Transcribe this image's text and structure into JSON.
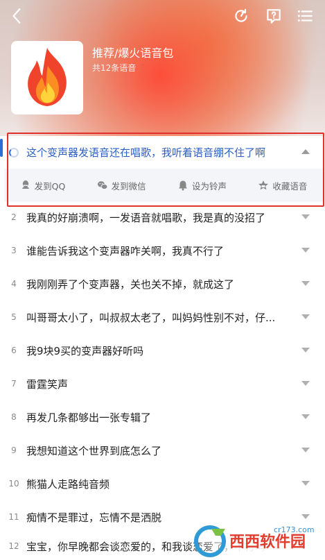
{
  "header": {
    "pack_title": "推荐/爆火语音包",
    "pack_count": "共12条语音"
  },
  "active": {
    "index": "1",
    "text": "这个变声器发语音还在唱歌，我听着语音绷不住了啊",
    "actions": [
      {
        "label": "发到QQ",
        "icon": "qq-icon"
      },
      {
        "label": "发到微信",
        "icon": "wechat-icon"
      },
      {
        "label": "设为铃声",
        "icon": "bell-icon"
      },
      {
        "label": "收藏语音",
        "icon": "star-icon"
      }
    ]
  },
  "items": [
    {
      "num": "2",
      "text": "我真的好崩溃啊，一发语音就唱歌，我是真的没招了"
    },
    {
      "num": "3",
      "text": "谁能告诉我这个变声器咋关啊，我真不行了"
    },
    {
      "num": "4",
      "text": "我刚刚弄了个变声器，关也关不掉，就成这了"
    },
    {
      "num": "5",
      "text": "叫哥哥太小了，叫叔叔太老了，叫妈妈性别不对，仔..."
    },
    {
      "num": "6",
      "text": "我9块9买的变声器好听吗"
    },
    {
      "num": "7",
      "text": "雷霆笑声"
    },
    {
      "num": "8",
      "text": "再发几条都够出一张专辑了"
    },
    {
      "num": "9",
      "text": "我想知道这个世界到底怎么了"
    },
    {
      "num": "10",
      "text": "熊猫人走路纯音频"
    },
    {
      "num": "11",
      "text": "痴情不是罪过，忘情不是洒脱"
    },
    {
      "num": "12",
      "text": "宝宝，你早晚都会谈恋爱的，和我谈恋爱了，不行吗"
    }
  ],
  "watermark": {
    "brand": "西西软件园",
    "url": "cr173.com"
  },
  "colors": {
    "accent": "#2b5fc4",
    "highlight_frame": "#e0302b"
  }
}
